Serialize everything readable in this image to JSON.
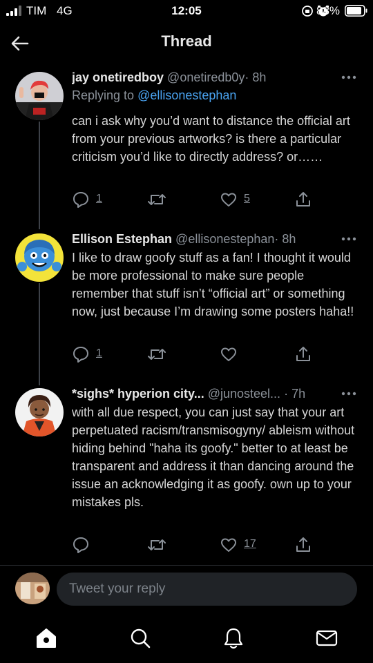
{
  "status_bar": {
    "carrier": "TIM",
    "network": "4G",
    "time": "12:05",
    "battery": "88%"
  },
  "header": {
    "title": "Thread"
  },
  "tweets": [
    {
      "name": "jay onetiredboy",
      "handle": "@onetiredb0y",
      "time": "· 8h",
      "reply_prefix": "Replying to ",
      "reply_to": "@ellisonestephan",
      "text": "can i ask why you’d want to distance the official art from your previous artworks? is there a particular criticism you’d like to directly address? or……",
      "replies": "1",
      "retweets": "",
      "likes": "5"
    },
    {
      "name": "Ellison Estephan",
      "handle": "@ellisonestephan",
      "time": "· 8h",
      "text": "I like to draw goofy stuff as a fan! I thought it would be more professional to make sure people remember that stuff isn’t “official art” or something now, just because I’m drawing some posters haha!!",
      "replies": "1",
      "retweets": "",
      "likes": ""
    },
    {
      "name": "*sighs* hyperion city...",
      "handle": "@junosteel...",
      "time": "· 7h",
      "text": "with all due respect, you can just say that your art perpetuated racism/transmisogyny/ ableism without hiding behind \"haha its goofy.\" better to at least be transparent and address it than dancing around the issue an acknowledging it as goofy. own up to your mistakes pls.",
      "replies": "",
      "retweets": "",
      "likes": "17"
    }
  ],
  "compose": {
    "placeholder": "Tweet your reply"
  },
  "tabs": [
    "home-icon",
    "search-icon",
    "notifications-icon",
    "messages-icon"
  ],
  "colors": {
    "background": "#000000",
    "link": "#4aa3f0",
    "muted": "#8b9199",
    "thread_line": "#3d4148"
  }
}
